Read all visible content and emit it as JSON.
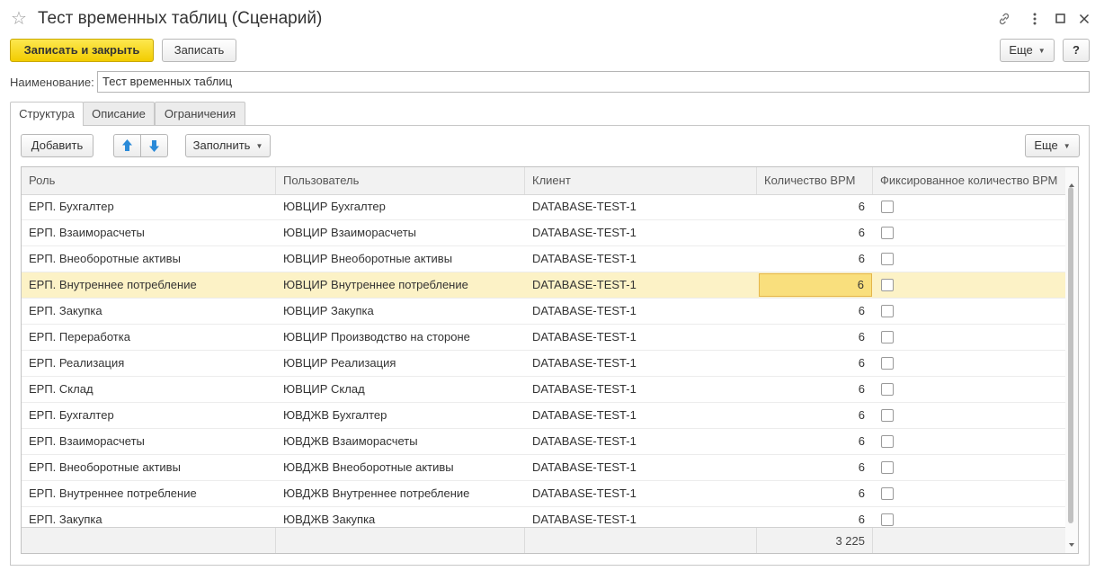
{
  "window": {
    "title": "Тест временных таблиц (Сценарий)"
  },
  "toolbar": {
    "save_close": "Записать и закрыть",
    "save": "Записать",
    "more": "Еще",
    "help": "?"
  },
  "form": {
    "name_label": "Наименование:",
    "name_value": "Тест временных таблиц"
  },
  "tabs": [
    "Структура",
    "Описание",
    "Ограничения"
  ],
  "table_toolbar": {
    "add": "Добавить",
    "fill": "Заполнить",
    "more": "Еще"
  },
  "table": {
    "columns": [
      "Роль",
      "Пользователь",
      "Клиент",
      "Количество ВРМ",
      "Фиксированное количество ВРМ"
    ],
    "rows": [
      {
        "role": "ЕРП. Бухгалтер",
        "user": "ЮВЦИР Бухгалтер",
        "client": "DATABASE-TEST-1",
        "count": "6",
        "fixed": false
      },
      {
        "role": "ЕРП. Взаиморасчеты",
        "user": "ЮВЦИР Взаиморасчеты",
        "client": "DATABASE-TEST-1",
        "count": "6",
        "fixed": false
      },
      {
        "role": "ЕРП. Внеоборотные активы",
        "user": "ЮВЦИР Внеоборотные активы",
        "client": "DATABASE-TEST-1",
        "count": "6",
        "fixed": false
      },
      {
        "role": "ЕРП. Внутреннее потребление",
        "user": "ЮВЦИР Внутреннее потребление",
        "client": "DATABASE-TEST-1",
        "count": "6",
        "fixed": false,
        "selected": true
      },
      {
        "role": "ЕРП. Закупка",
        "user": "ЮВЦИР Закупка",
        "client": "DATABASE-TEST-1",
        "count": "6",
        "fixed": false
      },
      {
        "role": "ЕРП. Переработка",
        "user": "ЮВЦИР Производство на стороне",
        "client": "DATABASE-TEST-1",
        "count": "6",
        "fixed": false
      },
      {
        "role": "ЕРП. Реализация",
        "user": "ЮВЦИР Реализация",
        "client": "DATABASE-TEST-1",
        "count": "6",
        "fixed": false
      },
      {
        "role": "ЕРП. Склад",
        "user": "ЮВЦИР Склад",
        "client": "DATABASE-TEST-1",
        "count": "6",
        "fixed": false
      },
      {
        "role": "ЕРП. Бухгалтер",
        "user": "ЮВДЖВ Бухгалтер",
        "client": "DATABASE-TEST-1",
        "count": "6",
        "fixed": false
      },
      {
        "role": "ЕРП. Взаиморасчеты",
        "user": "ЮВДЖВ Взаиморасчеты",
        "client": "DATABASE-TEST-1",
        "count": "6",
        "fixed": false
      },
      {
        "role": "ЕРП. Внеоборотные активы",
        "user": "ЮВДЖВ Внеоборотные активы",
        "client": "DATABASE-TEST-1",
        "count": "6",
        "fixed": false
      },
      {
        "role": "ЕРП. Внутреннее потребление",
        "user": "ЮВДЖВ Внутреннее потребление",
        "client": "DATABASE-TEST-1",
        "count": "6",
        "fixed": false
      },
      {
        "role": "ЕРП. Закупка",
        "user": "ЮВДЖВ Закупка",
        "client": "DATABASE-TEST-1",
        "count": "6",
        "fixed": false
      }
    ],
    "total_count": "3 225"
  },
  "colors": {
    "primary_button": "#f5d300",
    "selected_row": "#fcf2c6",
    "active_cell": "#f9df7d",
    "arrow_blue": "#2a8ad8"
  }
}
